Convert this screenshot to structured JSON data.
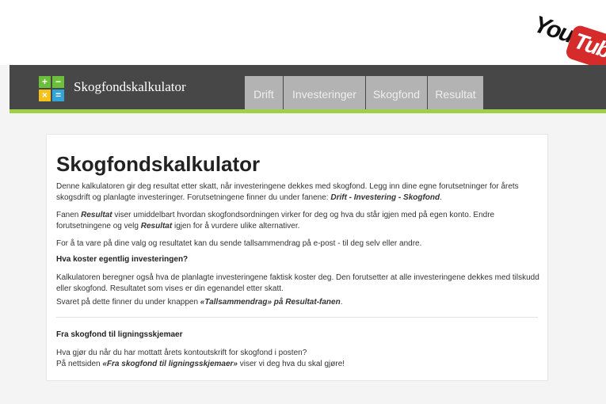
{
  "header": {
    "app_title": "Skogfondskalkulator",
    "logo_symbols": [
      "+",
      "−",
      "×",
      "="
    ],
    "tabs": [
      "Drift",
      "Investeringer",
      "Skogfond",
      "Resultat"
    ]
  },
  "watermark": {
    "text_part1": "You",
    "text_part2": "Tube"
  },
  "colors": {
    "header_bg": "#474747",
    "accent_green": "#9fd04a",
    "tab_bg": "#b3b3b3",
    "logo_green": "#6cbf3b",
    "logo_yellow": "#f4c21a",
    "logo_blue": "#34a4d8"
  },
  "content": {
    "title": "Skogfondskalkulator",
    "intro_a": "Denne kalkulatoren gir deg resultat etter skatt, når investeringene dekkes med skogfond. Legg inn dine egne forutsetninger for årets skogsdrift og planlagte investeringer. Forutsetningene finner du under fanene: ",
    "intro_b": "Drift - Investering - Skogfond",
    "intro_c": ".",
    "p2_a": "Fanen ",
    "p2_b": "Resultat",
    "p2_c": " viser umiddelbart hvordan skogfondsordningen virker for deg og hva du står igjen med på egen konto. Endre forutsetningene og velg ",
    "p2_d": "Resultat",
    "p2_e": " igjen for å vurdere ulike alternativer.",
    "p3": "For å ta vare på dine valg og resultatet kan du sende tallsammendrag på e-post - til deg selv eller andre.",
    "h2": "Hva koster egentlig investeringen?",
    "p4": "Kalkulatoren beregner også hva de planlagte investeringene faktisk koster deg. Den forutsetter at alle investeringene dekkes med tilskudd eller skogfond. Resultatet som vises er din egenandel etter skatt.",
    "p5_a": "Svaret på dette finner du under knappen ",
    "p5_b": "«Tallsammendrag» på Resultat-fanen",
    "p5_c": ".",
    "h3": "Fra skogfond til ligningsskjemaer",
    "p6": "Hva gjør du når du har mottatt årets kontoutskrift for skogfond i posten?",
    "p7_a": "På nettsiden ",
    "p7_b": "«Fra skogfond til ligningsskjemaer»",
    "p7_c": " viser vi deg hva du skal gjøre!"
  }
}
